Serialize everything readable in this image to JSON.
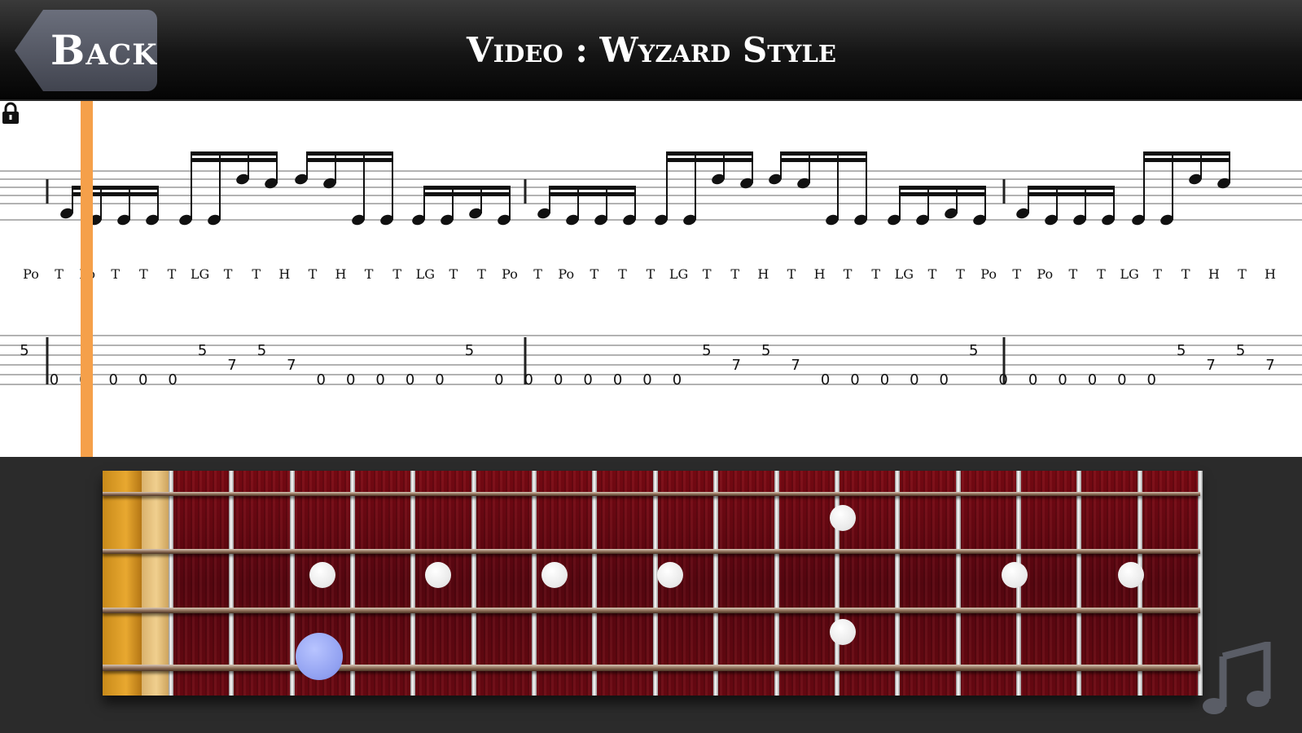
{
  "header": {
    "back_label": "Back",
    "title": "Video : Wyzard Style"
  },
  "score": {
    "technique_row": [
      "Po",
      "T",
      "Po",
      "T",
      "T",
      "T",
      "LG",
      "T",
      "T",
      "H",
      "T",
      "H",
      "T",
      "T",
      "LG",
      "T",
      "T",
      "Po",
      "T",
      "Po",
      "T",
      "T",
      "T",
      "LG",
      "T",
      "T",
      "H",
      "T",
      "H",
      "T",
      "T",
      "LG",
      "T",
      "T",
      "Po",
      "T",
      "Po",
      "T",
      "T",
      "LG",
      "T",
      "T",
      "H",
      "T",
      "H"
    ],
    "tab_row": [
      "5",
      "0",
      "0",
      "0",
      "0",
      "0",
      "5",
      "7",
      "5",
      "7",
      "0",
      "0",
      "0",
      "0",
      "0",
      "5",
      "0",
      "0",
      "0",
      "0",
      "0",
      "0",
      "0",
      "5",
      "7",
      "5",
      "7",
      "0",
      "0",
      "0",
      "0",
      "0",
      "5",
      "0",
      "0",
      "0",
      "0",
      "0",
      "0",
      "5",
      "7",
      "5",
      "7"
    ],
    "playhead_color": "#f5a04a",
    "lock_icon": "lock-icon"
  },
  "fretboard": {
    "fret_count": 17,
    "string_count": 4,
    "inlay_colors": "#ffffff",
    "current_note_color": "#8f9ff0",
    "music_icon": "music-note-icon"
  }
}
